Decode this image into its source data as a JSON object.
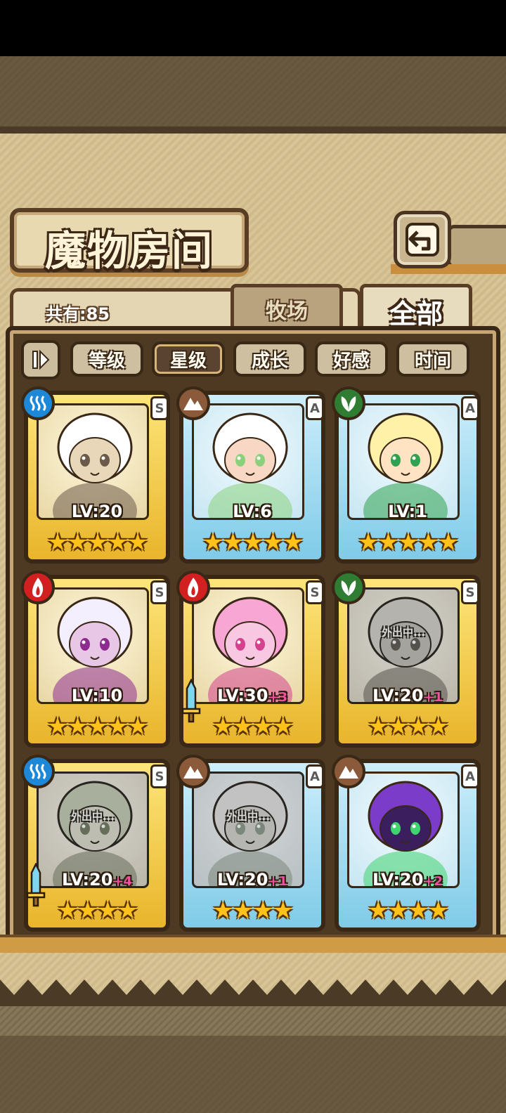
{
  "title": "魔物房间",
  "count_label": "共有:85",
  "tabs": [
    {
      "label": "牧场",
      "active": false
    },
    {
      "label": "全部",
      "active": true
    }
  ],
  "sort_buttons": [
    {
      "label": "等级",
      "active": false
    },
    {
      "label": "星级",
      "active": true
    },
    {
      "label": "成长",
      "active": false
    },
    {
      "label": "好感",
      "active": false
    },
    {
      "label": "时间",
      "active": false
    }
  ],
  "colors": {
    "element_water": "#1e88d8",
    "element_earth": "#8a5a3a",
    "element_nature": "#2e7d32",
    "element_fire": "#d21f1f",
    "star": "#ffc21a",
    "plus_text": "#f14fa1"
  },
  "cards": [
    {
      "element": "water-icon",
      "rank": "S",
      "frame": "gold",
      "level": "LV:20",
      "plus": "",
      "stars": 5,
      "out_label": "",
      "sword": false
    },
    {
      "element": "earth-icon",
      "rank": "A",
      "frame": "blue",
      "level": "LV:6",
      "plus": "",
      "stars": 5,
      "out_label": "",
      "sword": false
    },
    {
      "element": "nature-icon",
      "rank": "A",
      "frame": "blue",
      "level": "LV:1",
      "plus": "",
      "stars": 5,
      "out_label": "",
      "sword": false
    },
    {
      "element": "fire-icon",
      "rank": "S",
      "frame": "gold",
      "level": "LV:10",
      "plus": "",
      "stars": 5,
      "out_label": "",
      "sword": false
    },
    {
      "element": "fire-icon",
      "rank": "S",
      "frame": "gold",
      "level": "LV:30",
      "plus": "+3",
      "stars": 4,
      "out_label": "",
      "sword": true
    },
    {
      "element": "nature-icon",
      "rank": "S",
      "frame": "gold",
      "level": "LV:20",
      "plus": "+1",
      "stars": 4,
      "out_label": "外出中...",
      "sword": false
    },
    {
      "element": "water-icon",
      "rank": "S",
      "frame": "gold",
      "level": "LV:20",
      "plus": "+4",
      "stars": 4,
      "out_label": "外出中...",
      "sword": true
    },
    {
      "element": "earth-icon",
      "rank": "A",
      "frame": "blue",
      "level": "LV:20",
      "plus": "+1",
      "stars": 4,
      "out_label": "外出中...",
      "sword": false
    },
    {
      "element": "earth-icon",
      "rank": "A",
      "frame": "blue",
      "level": "LV:20",
      "plus": "+2",
      "stars": 4,
      "out_label": "",
      "sword": false
    }
  ]
}
